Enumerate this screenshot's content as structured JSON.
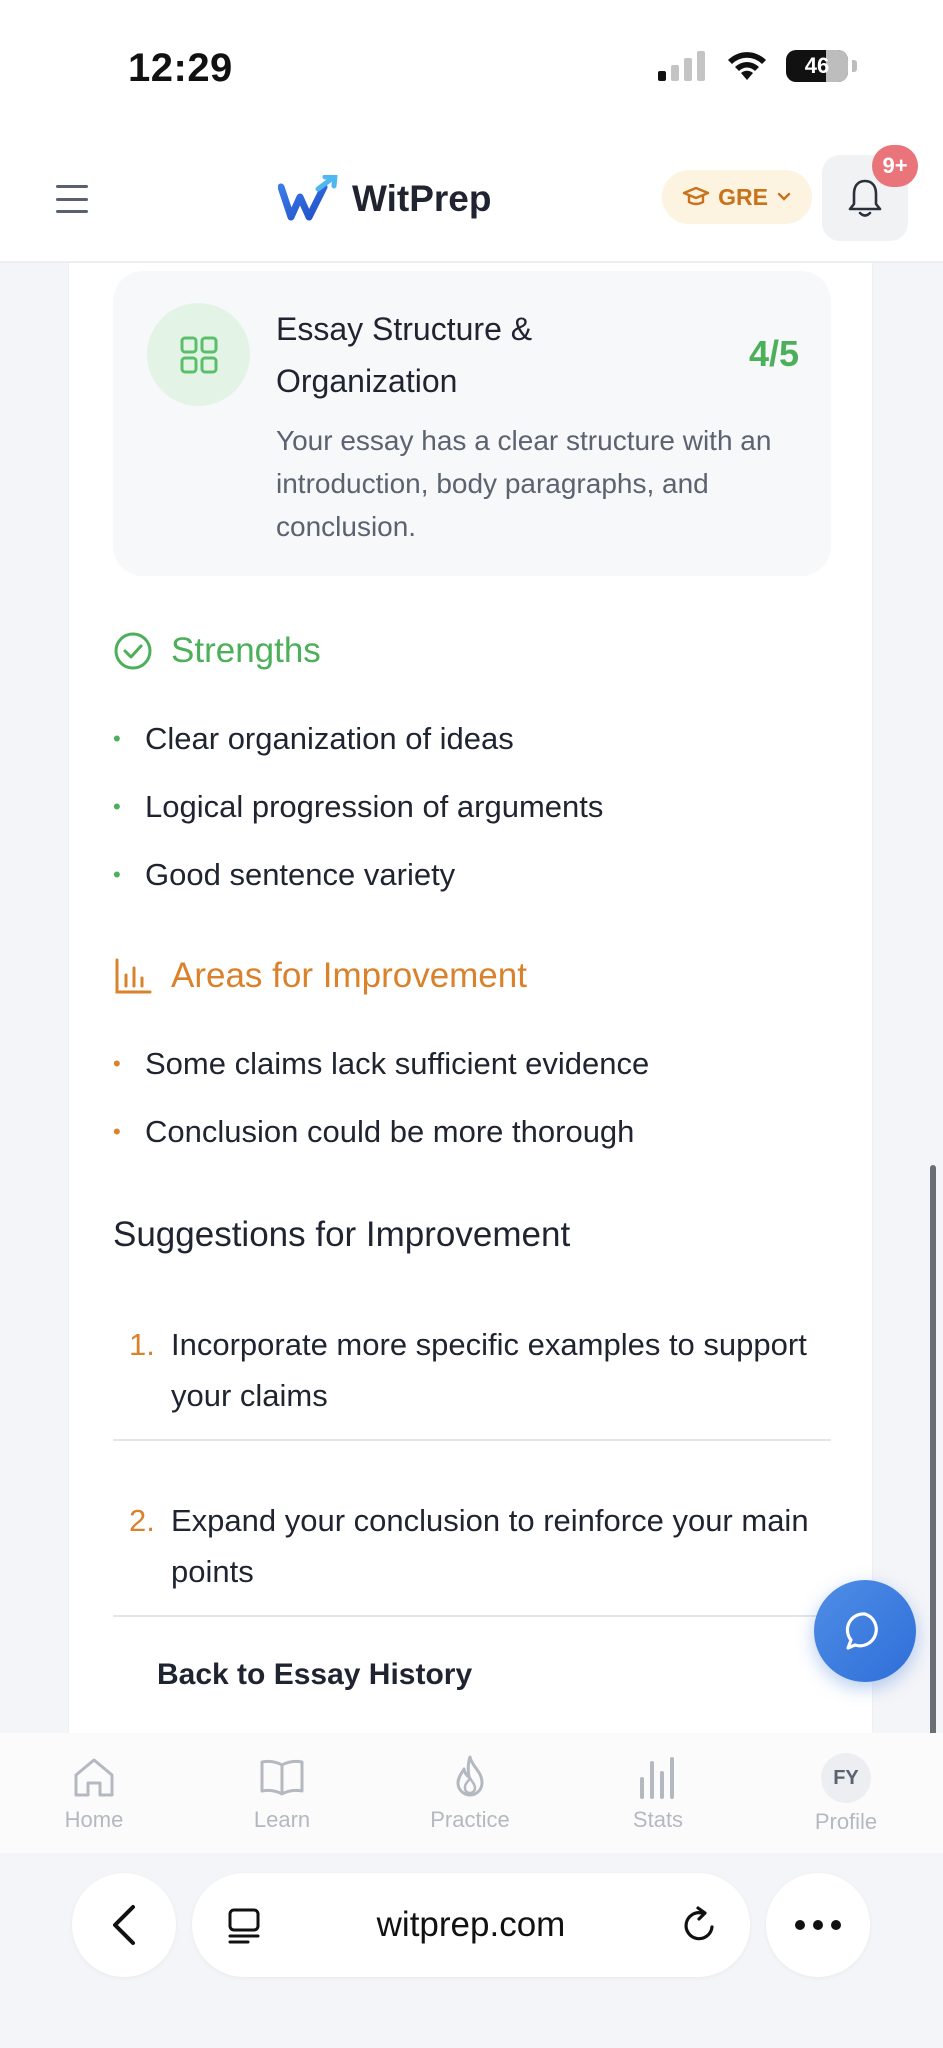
{
  "status_bar": {
    "time": "12:29",
    "battery": "46"
  },
  "header": {
    "app_name": "WitPrep",
    "exam_selector": "GRE",
    "notification_badge": "9+"
  },
  "criterion": {
    "title": "Essay Structure & Organization",
    "score": "4/5",
    "description": "Your essay has a clear structure with an introduction, body paragraphs, and conclusion."
  },
  "strengths": {
    "title": "Strengths",
    "items": [
      "Clear organization of ideas",
      "Logical progression of arguments",
      "Good sentence variety"
    ]
  },
  "areas": {
    "title": "Areas for Improvement",
    "items": [
      "Some claims lack sufficient evidence",
      "Conclusion could be more thorough"
    ]
  },
  "suggestions": {
    "title": "Suggestions for Improvement",
    "items": [
      {
        "num": "1.",
        "text": "Incorporate more specific examples to support your claims"
      },
      {
        "num": "2.",
        "text": "Expand your conclusion to reinforce your main points"
      }
    ]
  },
  "back_link": "Back to Essay History",
  "bottom_nav": [
    {
      "label": "Home",
      "icon": "home-icon"
    },
    {
      "label": "Learn",
      "icon": "book-icon"
    },
    {
      "label": "Practice",
      "icon": "flame-icon"
    },
    {
      "label": "Stats",
      "icon": "bar-chart-icon"
    },
    {
      "label": "Profile",
      "avatar": "FY"
    }
  ],
  "browser": {
    "url": "witprep.com"
  },
  "colors": {
    "success": "#4caf5a",
    "warning": "#d9822b",
    "badge": "#e9747a",
    "fab": "#2f6fd8"
  }
}
